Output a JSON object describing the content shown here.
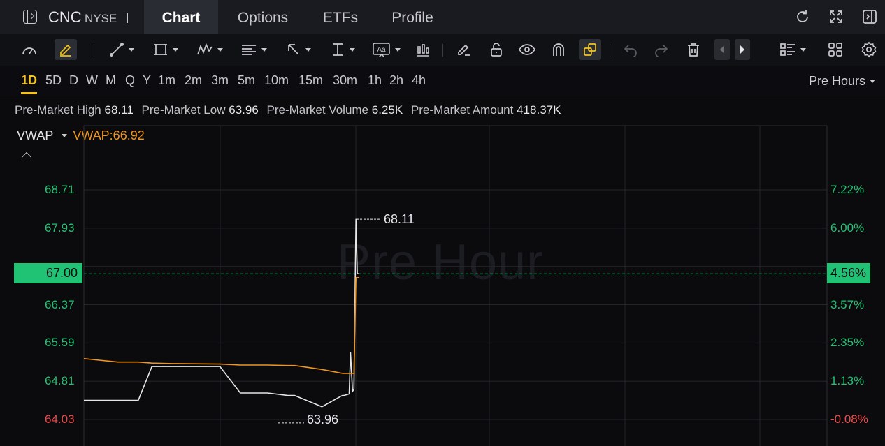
{
  "header": {
    "symbol": "CNC",
    "exchange": "NYSE",
    "tabs": [
      {
        "label": "Chart",
        "active": true
      },
      {
        "label": "Options",
        "active": false
      },
      {
        "label": "ETFs",
        "active": false
      },
      {
        "label": "Profile",
        "active": false
      }
    ],
    "right_icons": [
      "refresh-icon",
      "expand-icon",
      "collapse-panel-icon"
    ]
  },
  "toolbar": {
    "tools": [
      "speed-gauge-icon",
      "draw-mode-icon",
      "trend-line-icon",
      "rectangle-icon",
      "pattern-icon",
      "fibonacci-icon",
      "arrow-icon",
      "measure-icon",
      "text-icon",
      "indicator-icon",
      "eraser-icon",
      "lock-icon",
      "visibility-icon",
      "magnet-icon",
      "sync-icon",
      "undo-icon",
      "redo-icon",
      "delete-icon",
      "scroll-left-icon",
      "scroll-right-icon",
      "layout-list-icon",
      "grid-icon",
      "settings-icon"
    ],
    "text_tool_label": "Aa"
  },
  "timeframes": {
    "items": [
      "1D",
      "5D",
      "D",
      "W",
      "M",
      "Q",
      "Y",
      "1m",
      "2m",
      "3m",
      "5m",
      "10m",
      "15m",
      "30m",
      "1h",
      "2h",
      "4h"
    ],
    "active": "1D",
    "session": "Pre Hours"
  },
  "info": {
    "high_label": "Pre-Market High",
    "high": "68.11",
    "low_label": "Pre-Market Low",
    "low": "63.96",
    "volume_label": "Pre-Market Volume",
    "volume": "6.25K",
    "amount_label": "Pre-Market Amount",
    "amount": "418.37K"
  },
  "indicator": {
    "name": "VWAP",
    "value_text": "VWAP:66.92"
  },
  "colors": {
    "up": "#23c173",
    "down": "#f04848",
    "price_line": "#e6e6e6",
    "vwap_line": "#f0961e",
    "active_tab": "#f3c51b"
  },
  "chart_data": {
    "type": "line",
    "watermark": "Pre Hour",
    "y_left_ticks": [
      "68.71",
      "67.93",
      "66.37",
      "65.59",
      "64.81",
      "64.03"
    ],
    "y_right_ticks": [
      "7.22%",
      "6.00%",
      "3.57%",
      "2.35%",
      "1.13%",
      "-0.08%"
    ],
    "current_price": "67.00",
    "current_change": "4.56%",
    "high_annotation": "68.11",
    "low_annotation": "63.96",
    "ylim": [
      63.5,
      69.5
    ],
    "x": [
      0,
      0.5,
      0.8,
      1.0,
      1.3,
      2.0,
      2.3,
      2.7,
      3.0,
      3.1,
      3.5,
      3.8,
      3.82,
      3.9,
      3.92,
      3.95,
      3.97,
      4.0,
      4.02,
      4.05
    ],
    "series": [
      {
        "values": [
          64.42,
          64.42,
          64.42,
          65.11,
          65.11,
          65.11,
          64.57,
          64.57,
          64.52,
          64.52,
          64.29,
          64.52,
          64.52,
          64.55,
          65.4,
          64.6,
          64.65,
          68.11,
          67.0,
          67.0
        ]
      },
      {
        "values": [
          65.27,
          65.2,
          65.2,
          65.18,
          65.17,
          65.16,
          65.14,
          65.14,
          65.13,
          65.13,
          65.05,
          64.97,
          64.97,
          64.97,
          64.97,
          64.97,
          64.97,
          66.92,
          66.92,
          66.92
        ]
      }
    ]
  }
}
